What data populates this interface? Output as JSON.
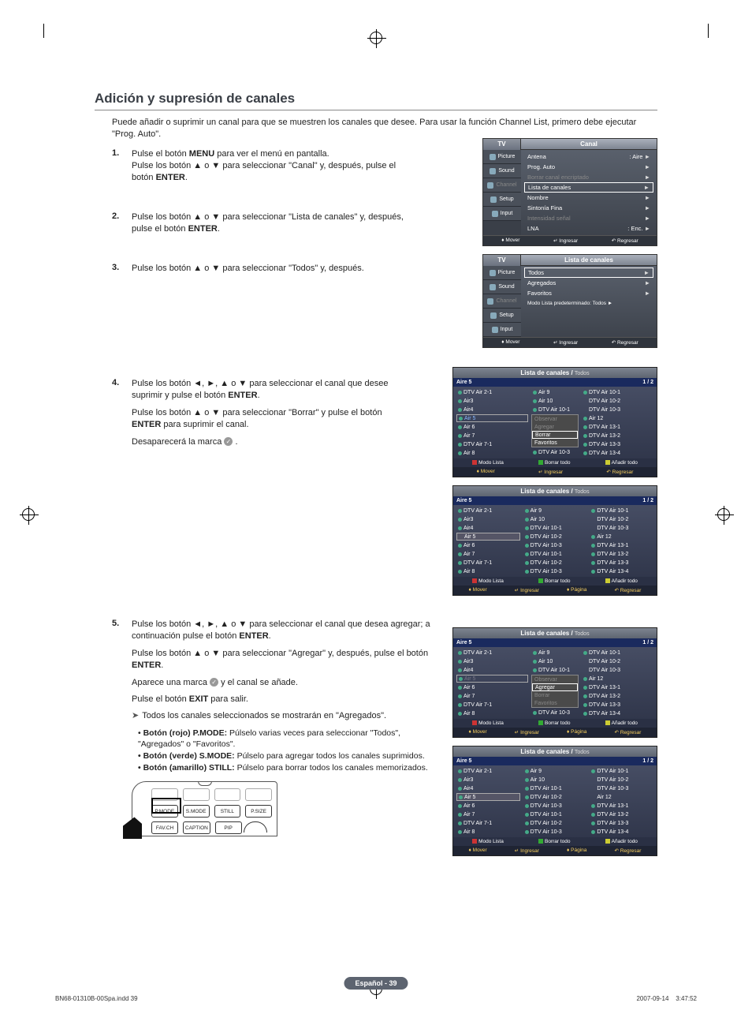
{
  "title": "Adición y supresión de canales",
  "intro": "Puede añadir o suprimir un canal para que se muestren los canales que desee. Para usar la función Channel List, primero debe ejecutar \"Prog. Auto\".",
  "steps": {
    "s1a": "Pulse el botón MENU para ver el menú en pantalla.",
    "s1b": "Pulse los botón ▲ o ▼ para seleccionar \"Canal\" y, después, pulse el botón ENTER.",
    "s2": "Pulse los botón ▲ o ▼ para seleccionar \"Lista de canales\" y, después, pulse el botón ENTER.",
    "s3": "Pulse los botón ▲ o ▼ para seleccionar \"Todos\" y, después.",
    "s4a": "Pulse los botón ◄, ►, ▲ o ▼ para seleccionar el canal que desee suprimir y pulse el botón ENTER.",
    "s4b": "Pulse los botón ▲ o ▼ para seleccionar \"Borrar\" y pulse el botón ENTER para suprimir el canal.",
    "s4c": "Desaparecerá la marca",
    "s5a": "Pulse los botón ◄, ►, ▲ o ▼ para seleccionar el canal que desea agregar; a continuación pulse el botón ENTER.",
    "s5b": "Pulse los botón ▲ o ▼ para seleccionar \"Agregar\" y, después, pulse el botón ENTER.",
    "s5c": "Aparece una marca",
    "s5c2": "y  el canal se añade.",
    "s5d": "Pulse el botón EXIT para salir.",
    "s5e": "Todos los canales seleccionados se mostrarán en \"Agregados\"."
  },
  "buttons_note": {
    "pmode": "Botón (rojo) P.MODE:",
    "pmode_txt": " Púlselo varias veces para seleccionar \"Todos\", \"Agregados\" o \"Favoritos\".",
    "smode": "Botón (verde) S.MODE:",
    "smode_txt": " Púlselo para agregar todos los canales suprimidos.",
    "still": "Botón (amarillo) STILL:",
    "still_txt": " Púlselo para borrar todos los canales memorizados."
  },
  "remote": {
    "pmode": "P.MODE",
    "smode": "S.MODE",
    "still": "STILL",
    "psize": "P.SIZE",
    "favch": "FAV.CH",
    "caption": "CAPTION",
    "pip": "PIP"
  },
  "menu1": {
    "tv": "TV",
    "title": "Canal",
    "antena": "Antena",
    "antena_v": ": Aire",
    "prog": "Prog. Auto",
    "borrar": "Borrar canal encriptado",
    "lista": "Lista de canales",
    "nombre": "Nombre",
    "sint": "Sintonía Fina",
    "intens": "Intensidad señal",
    "lna": "LNA",
    "lna_v": ": Enc.",
    "tabs": {
      "picture": "Picture",
      "sound": "Sound",
      "channel": "Channel",
      "setup": "Setup",
      "input": "Input"
    },
    "bar": {
      "mover": "Mover",
      "ingresar": "Ingresar",
      "regresar": "Regresar"
    }
  },
  "menu2": {
    "title": "Lista de canales",
    "todos": "Todos",
    "agreg": "Agregados",
    "fav": "Favoritos",
    "modo": "Modo Lista predeterminado: Todos ►"
  },
  "cl": {
    "title": "Lista de canales",
    "todos": "Todos",
    "curr": "Aire 5",
    "page": "1 / 2",
    "col1": [
      "DTV Air 2-1",
      "Air3",
      "Air4",
      "Air 5",
      "Air 6",
      "Air 7",
      "DTV Air 7-1",
      "Air 8"
    ],
    "col2": [
      "Air 9",
      "Air 10",
      "DTV Air 10-1",
      "",
      "",
      "",
      "",
      "DTV Air 10-3"
    ],
    "col2b": [
      "Air 9",
      "Air 10",
      "DTV Air 10-1",
      "DTV Air 10-2",
      "DTV Air 10-3",
      "DTV Air 10-1",
      "DTV Air 10-2",
      "DTV Air 10-3"
    ],
    "col3": [
      "DTV Air 10-1",
      "DTV Air 10-2",
      "DTV Air 10-3",
      "Air 12",
      "DTV Air 13-1",
      "DTV Air 13-2",
      "DTV Air 13-3",
      "DTV Air 13-4"
    ],
    "ctx": {
      "observar": "Observar",
      "agregar": "Agregar",
      "borrar": "Borrar",
      "favoritos": "Favoritos"
    },
    "legend": {
      "modo": "Modo Lista",
      "borrar": "Borrar todo",
      "anadir": "Añadir todo"
    },
    "bar": {
      "mover": "Mover",
      "ingresar": "Ingresar",
      "pagina": "Página",
      "regresar": "Regresar"
    }
  },
  "page_badge": "Español - 39",
  "foot_l": "BN68-01310B-00Spa.indd   39",
  "foot_r": "2007-09-14      3:47:52"
}
